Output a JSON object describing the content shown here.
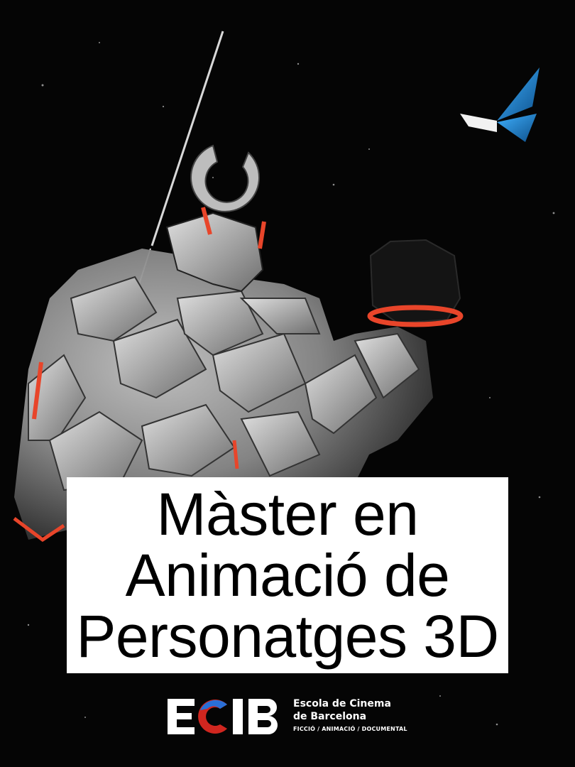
{
  "poster": {
    "title_lines": [
      "Màster en",
      "Animació de",
      "Personatges 3D"
    ]
  },
  "logo": {
    "wordmark": "ECIB",
    "name_line1": "Escola de Cinema",
    "name_line2": "de Barcelona",
    "tagline": "FICCIÓ / ANIMACIÓ / DOCUMENTAL"
  },
  "colors": {
    "background": "#050505",
    "accent_orange": "#e8452a",
    "butterfly_blue": "#1f8fd6",
    "logo_red": "#d0261f",
    "logo_blue": "#2a6fd6"
  }
}
